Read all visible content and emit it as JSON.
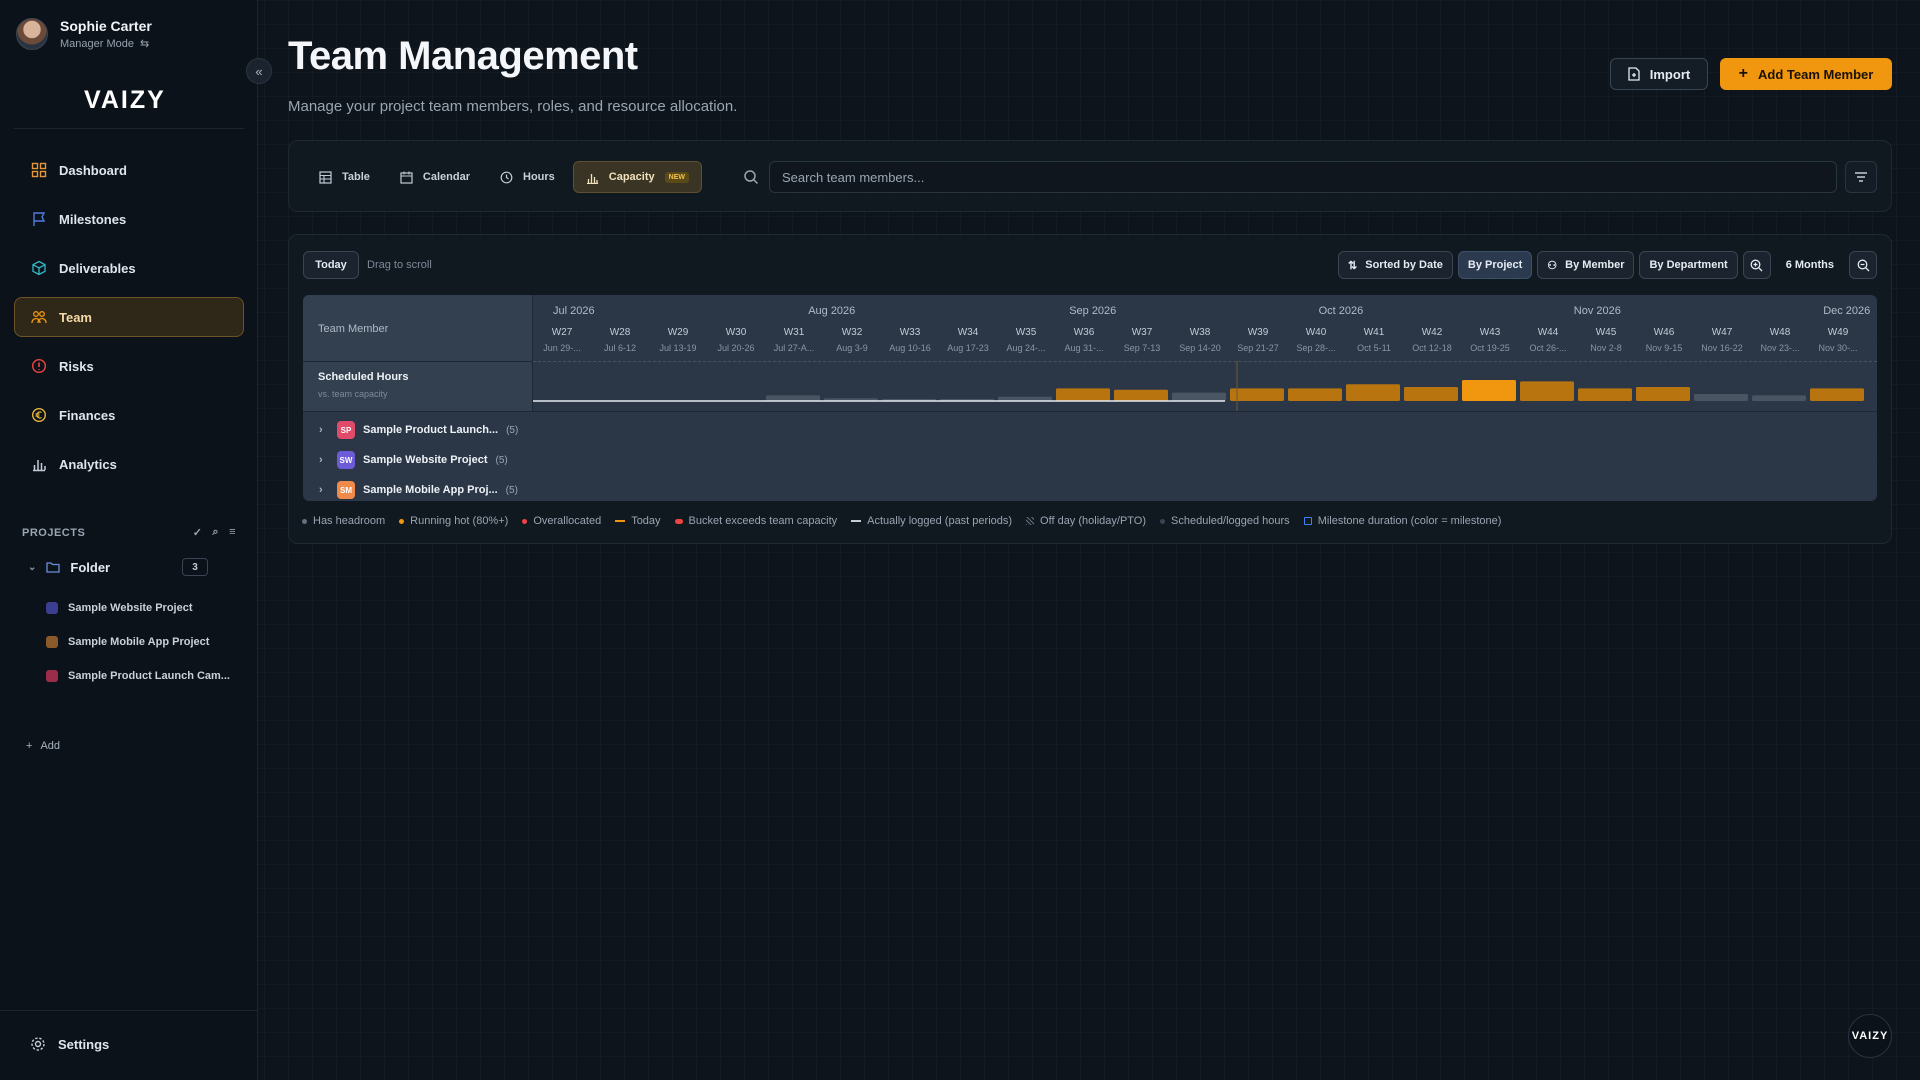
{
  "user": {
    "name": "Sophie Carter",
    "mode": "Manager Mode"
  },
  "brand": {
    "logo": "VAIZY"
  },
  "nav": [
    {
      "label": "Dashboard",
      "icon": "dashboard-icon"
    },
    {
      "label": "Milestones",
      "icon": "flag-icon"
    },
    {
      "label": "Deliverables",
      "icon": "cube-icon"
    },
    {
      "label": "Team",
      "icon": "team-icon",
      "active": true
    },
    {
      "label": "Risks",
      "icon": "alert-icon"
    },
    {
      "label": "Finances",
      "icon": "euro-icon"
    },
    {
      "label": "Analytics",
      "icon": "bar-chart-icon"
    }
  ],
  "projects": {
    "heading": "PROJECTS",
    "folder": {
      "name": "Folder",
      "count": "3"
    },
    "items": [
      {
        "name": "Sample Website Project",
        "color": "#3b3f8f"
      },
      {
        "name": "Sample Mobile App Project",
        "color": "#8a5a2b"
      },
      {
        "name": "Sample Product Launch Cam...",
        "color": "#9b2d4a"
      }
    ],
    "add_label": "Add"
  },
  "settings_label": "Settings",
  "page": {
    "title": "Team Management",
    "subtitle": "Manage your project team members, roles, and resource allocation."
  },
  "actions": {
    "import_label": "Import",
    "add_member_label": "Add Team Member"
  },
  "views": [
    {
      "label": "Table"
    },
    {
      "label": "Calendar"
    },
    {
      "label": "Hours"
    },
    {
      "label": "Capacity",
      "badge": "NEW",
      "active": true
    }
  ],
  "search": {
    "placeholder": "Search team members..."
  },
  "capacity": {
    "today_label": "Today",
    "drag_hint": "Drag to scroll",
    "sort_label": "Sorted by Date",
    "group_by": [
      "By Project",
      "By Member",
      "By Department"
    ],
    "selected_group": "By Project",
    "range_label": "6 Months",
    "column_header": "Team Member",
    "scheduled_title": "Scheduled Hours",
    "scheduled_sub": "vs. team capacity",
    "months": [
      "Jul 2026",
      "Aug 2026",
      "Sep 2026",
      "Oct 2026",
      "Nov 2026",
      "Dec 2026"
    ],
    "weeks": [
      {
        "w": "W27",
        "d": "Jun 29-..."
      },
      {
        "w": "W28",
        "d": "Jul 6-12"
      },
      {
        "w": "W29",
        "d": "Jul 13-19"
      },
      {
        "w": "W30",
        "d": "Jul 20-26"
      },
      {
        "w": "W31",
        "d": "Jul 27-A..."
      },
      {
        "w": "W32",
        "d": "Aug 3-9"
      },
      {
        "w": "W33",
        "d": "Aug 10-16"
      },
      {
        "w": "W34",
        "d": "Aug 17-23"
      },
      {
        "w": "W35",
        "d": "Aug 24-..."
      },
      {
        "w": "W36",
        "d": "Aug 31-..."
      },
      {
        "w": "W37",
        "d": "Sep 7-13"
      },
      {
        "w": "W38",
        "d": "Sep 14-20"
      },
      {
        "w": "W39",
        "d": "Sep 21-27"
      },
      {
        "w": "W40",
        "d": "Sep 28-..."
      },
      {
        "w": "W41",
        "d": "Oct 5-11"
      },
      {
        "w": "W42",
        "d": "Oct 12-18"
      },
      {
        "w": "W43",
        "d": "Oct 19-25"
      },
      {
        "w": "W44",
        "d": "Oct 26-..."
      },
      {
        "w": "W45",
        "d": "Nov 2-8"
      },
      {
        "w": "W46",
        "d": "Nov 9-15"
      },
      {
        "w": "W47",
        "d": "Nov 16-22"
      },
      {
        "w": "W48",
        "d": "Nov 23-..."
      },
      {
        "w": "W49",
        "d": "Nov 30-..."
      }
    ],
    "load": [
      0,
      0,
      0,
      0,
      0.2,
      0.1,
      0.05,
      0.05,
      0.15,
      0.45,
      0.4,
      0.3,
      0.45,
      0.45,
      0.6,
      0.5,
      0.75,
      0.7,
      0.45,
      0.5,
      0.25,
      0.2,
      0.45
    ],
    "load_status": [
      "none",
      "none",
      "none",
      "none",
      "headroom",
      "headroom",
      "headroom",
      "headroom",
      "headroom",
      "hot",
      "hot",
      "headroom",
      "hot",
      "hot",
      "hot",
      "hot",
      "peak",
      "hot",
      "hot",
      "hot",
      "headroom",
      "headroom",
      "hot"
    ],
    "rows": [
      {
        "abbr": "SP",
        "name": "Sample Product Launch...",
        "count": "(5)",
        "color": "#e14b6a"
      },
      {
        "abbr": "SW",
        "name": "Sample Website Project",
        "count": "(5)",
        "color": "#6b5bd6"
      },
      {
        "abbr": "SM",
        "name": "Sample Mobile App Proj...",
        "count": "(5)",
        "color": "#f08a4b"
      }
    ]
  },
  "legend": [
    {
      "label": "Has headroom",
      "kind": "dot",
      "color": "#64707e"
    },
    {
      "label": "Running hot (80%+)",
      "kind": "dot",
      "color": "#f0960f"
    },
    {
      "label": "Overallocated",
      "kind": "dot",
      "color": "#ef4444"
    },
    {
      "label": "Today",
      "kind": "line",
      "color": "#f0960f"
    },
    {
      "label": "Bucket exceeds team capacity",
      "kind": "pill",
      "color": "#ef4444"
    },
    {
      "label": "Actually logged (past periods)",
      "kind": "line",
      "color": "#c3ccd6"
    },
    {
      "label": "Off day (holiday/PTO)",
      "kind": "hatch",
      "color": "#64707e"
    },
    {
      "label": "Scheduled/logged hours",
      "kind": "dot",
      "color": "#3a4553"
    },
    {
      "label": "Milestone duration (color = milestone)",
      "kind": "box",
      "color": "#3b82f6"
    }
  ]
}
